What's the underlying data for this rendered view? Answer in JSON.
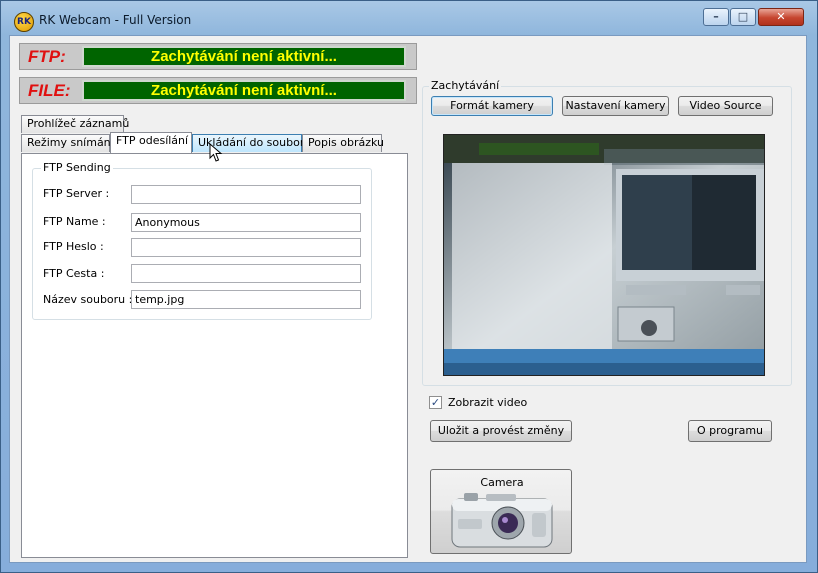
{
  "window": {
    "title": "RK Webcam - Full Version",
    "icon": "webcam-app-icon",
    "controls": [
      "minimize-icon",
      "maximize-icon",
      "close-icon"
    ]
  },
  "status": {
    "ftp_label": "FTP:",
    "ftp_value": "Zachytávání není aktivní...",
    "file_label": "FILE:",
    "file_value": "Zachytávání není aktivní..."
  },
  "tabs": {
    "row1": [
      {
        "label": "Prohlížeč záznamů"
      }
    ],
    "row2": [
      {
        "label": "Režimy snímání"
      },
      {
        "label": "FTP odesílání",
        "active": true
      },
      {
        "label": "Ukládání do souboru",
        "hover": true
      },
      {
        "label": "Popis obrázku"
      }
    ]
  },
  "ftp_group": {
    "title": "FTP Sending",
    "fields": [
      {
        "label": "FTP Server :",
        "value": ""
      },
      {
        "label": "FTP Name :",
        "value": "Anonymous"
      },
      {
        "label": "FTP Heslo :",
        "value": ""
      },
      {
        "label": "FTP Cesta :",
        "value": ""
      },
      {
        "label": "Název souboru :",
        "value": "temp.jpg"
      }
    ]
  },
  "capture": {
    "title": "Zachytávání",
    "buttons": [
      "Formát kamery",
      "Nastavení kamery",
      "Video Source"
    ]
  },
  "show_video": {
    "label": "Zobrazit video",
    "checked": true
  },
  "actions": {
    "save": "Uložit a provést změny",
    "about": "O programu"
  },
  "camera_button": {
    "label": "Camera"
  },
  "colors": {
    "status_bg": "#006400",
    "status_text": "#ffff00",
    "status_label": "#e01010"
  }
}
